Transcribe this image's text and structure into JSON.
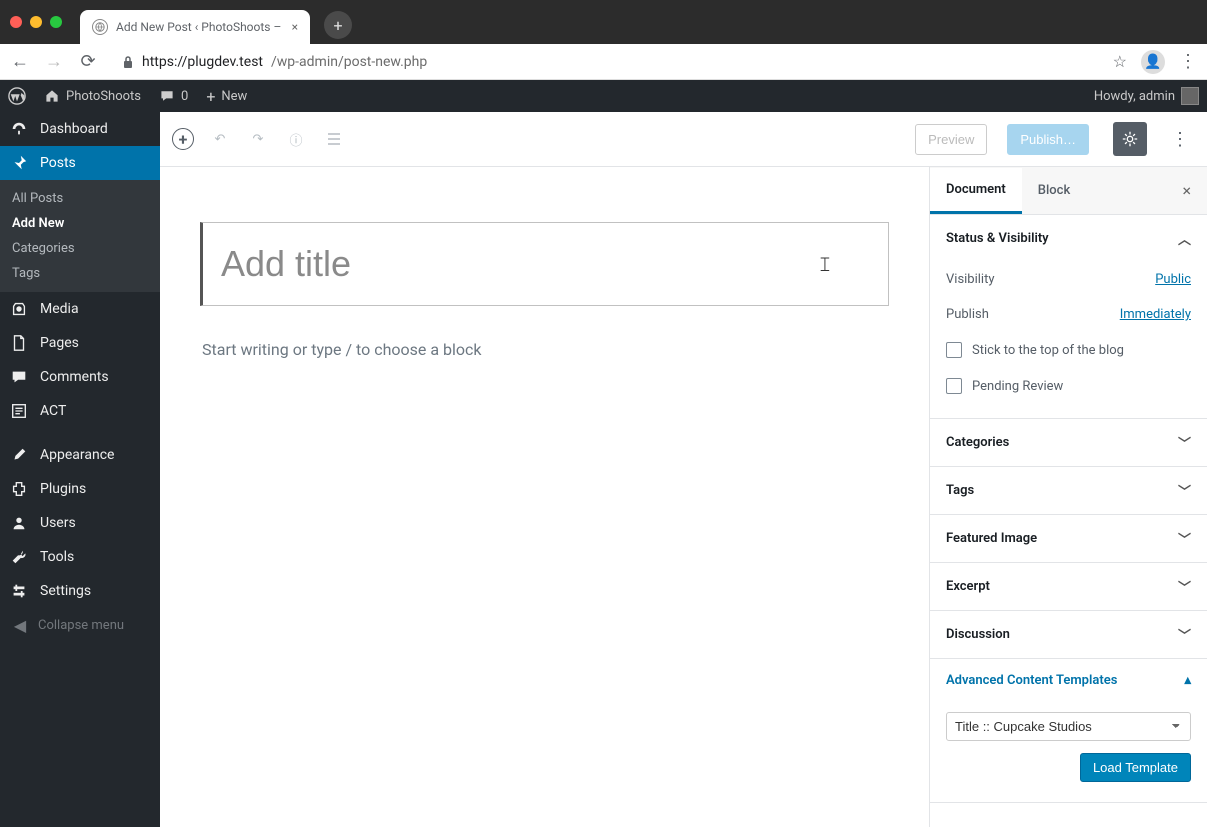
{
  "browser": {
    "tab_title": "Add New Post ‹ PhotoShoots –",
    "url_host": "https://plugdev.test",
    "url_path": "/wp-admin/post-new.php"
  },
  "adminbar": {
    "site_name": "PhotoShoots",
    "comments_count": "0",
    "new_label": "New",
    "howdy": "Howdy, admin"
  },
  "sidebar": {
    "dashboard": "Dashboard",
    "posts": "Posts",
    "submenu": {
      "all": "All Posts",
      "add": "Add New",
      "cats": "Categories",
      "tags": "Tags"
    },
    "media": "Media",
    "pages": "Pages",
    "comments": "Comments",
    "act": "ACT",
    "appearance": "Appearance",
    "plugins": "Plugins",
    "users": "Users",
    "tools": "Tools",
    "settings": "Settings",
    "collapse": "Collapse menu"
  },
  "editor": {
    "preview_label": "Preview",
    "publish_label": "Publish…",
    "title_placeholder": "Add title",
    "body_placeholder": "Start writing or type / to choose a block"
  },
  "settings": {
    "tab_document": "Document",
    "tab_block": "Block",
    "status_visibility": {
      "title": "Status & Visibility",
      "visibility_label": "Visibility",
      "visibility_value": "Public",
      "publish_label": "Publish",
      "publish_value": "Immediately",
      "stick_label": "Stick to the top of the blog",
      "pending_label": "Pending Review"
    },
    "panels": {
      "categories": "Categories",
      "tags": "Tags",
      "featured_image": "Featured Image",
      "excerpt": "Excerpt",
      "discussion": "Discussion",
      "act": "Advanced Content Templates"
    },
    "act": {
      "selected": "Title :: Cupcake Studios",
      "load_button": "Load Template"
    }
  }
}
